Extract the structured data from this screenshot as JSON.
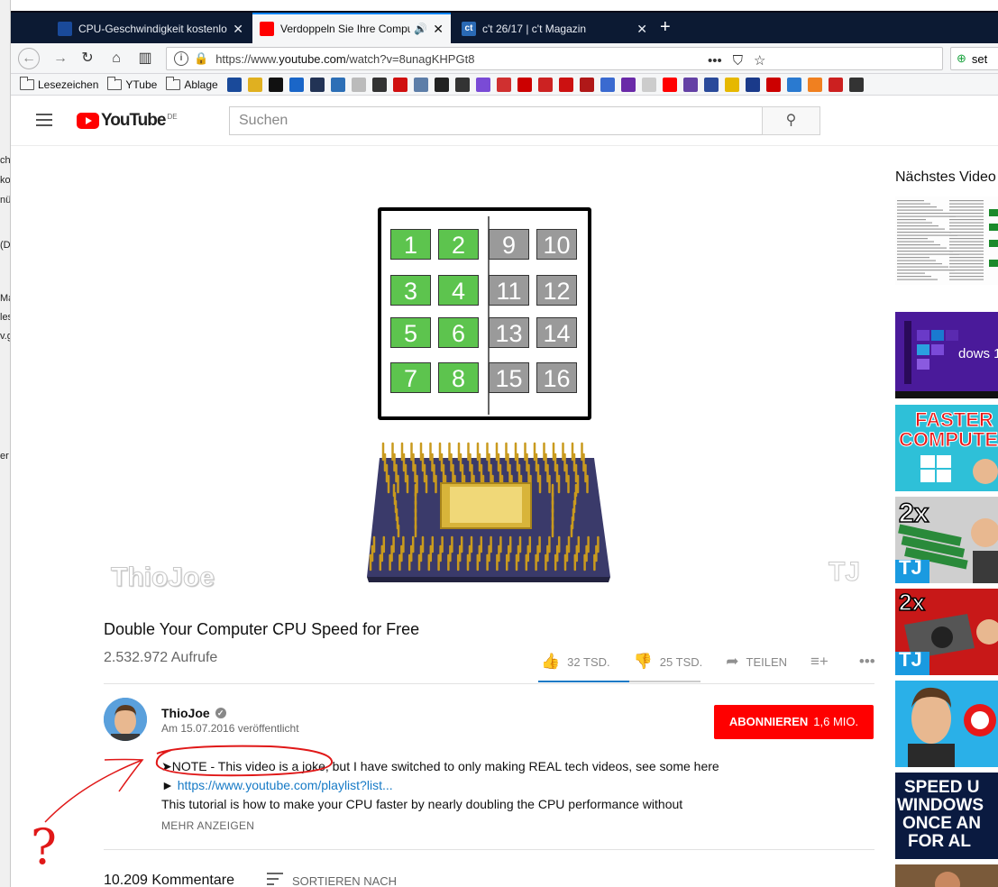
{
  "browser": {
    "tabs": [
      {
        "title": "CPU-Geschwindigkeit kostenlos",
        "favicon": "cb-icon",
        "close": "✕"
      },
      {
        "title": "Verdoppeln Sie Ihre Computer",
        "favicon": "youtube-icon",
        "close": "✕",
        "active": true
      },
      {
        "title": "c't 26/17 | c't Magazin",
        "favicon": "ct-icon",
        "close": "✕"
      }
    ],
    "new_tab": "+",
    "url_prefix": "https://www.",
    "url_host": "youtube.com",
    "url_path": "/watch?v=8unagKHPGt8",
    "search_text": "set",
    "bookmarks": [
      {
        "label": "Lesezeichen"
      },
      {
        "label": "YTube"
      },
      {
        "label": "Ablage"
      }
    ],
    "bookmark_icon_colors": [
      "#1a4a9a",
      "#e0b020",
      "#111111",
      "#1a66c8",
      "#223355",
      "#2d6fb6",
      "#bbbbbb",
      "#333333",
      "#d01010",
      "#5d7ea8",
      "#222222",
      "#333333",
      "#7a4bd6",
      "#d03030",
      "#cc0000",
      "#cc2222",
      "#cc1111",
      "#b01818",
      "#3a6ad0",
      "#6a2aa8",
      "#cccccc",
      "#ff0000",
      "#6441a5",
      "#2a4a9a",
      "#e6b800",
      "#1a3a8a",
      "#cc0000",
      "#2a7ad0",
      "#f08020",
      "#cc2020",
      "#333333"
    ]
  },
  "youtube": {
    "logo_word": "YouTube",
    "region": "DE",
    "search_placeholder": "Suchen",
    "video": {
      "green_cells": [
        "1",
        "2",
        "3",
        "4",
        "5",
        "6",
        "7",
        "8"
      ],
      "gray_cells": [
        "9",
        "10",
        "11",
        "12",
        "13",
        "14",
        "15",
        "16"
      ],
      "watermark_left": "ThioJoe",
      "watermark_right": "TJ"
    },
    "title": "Double Your Computer CPU Speed for Free",
    "views": "2.532.972 Aufrufe",
    "likes": "32 TSD.",
    "dislikes": "25 TSD.",
    "like_ratio": 0.56,
    "share": "TEILEN",
    "channel": "ThioJoe",
    "published": "Am 15.07.2016 veröffentlicht",
    "subscribe": "ABONNIEREN",
    "subscribers": "1,6 MIO.",
    "description": {
      "line1": "➤NOTE - This video is a joke, but I have switched to only making REAL tech videos, see some here",
      "line2_prefix": "► ",
      "line2_link": "https://www.youtube.com/playlist?list...",
      "line3": "This tutorial is how to make your CPU faster by nearly doubling the CPU performance without"
    },
    "show_more": "MEHR ANZEIGEN",
    "comments": "10.209 Kommentare",
    "sort": "SORTIEREN NACH",
    "up_next": "Nächstes Video"
  },
  "sidebar_thumbs": [
    {
      "text": ""
    },
    {
      "text": "dows 1"
    },
    {
      "text_1": "FASTER",
      "text_2": "COMPUTER"
    },
    {
      "text_1": "2x",
      "text_2": "TJ"
    },
    {
      "text_1": "2x",
      "text_2": "TJ"
    },
    {
      "text": ""
    },
    {
      "text_1": "SPEED U",
      "text_2": "WINDOWS",
      "text_3": "ONCE AN",
      "text_4": "FOR AL"
    }
  ],
  "behind_window": [
    "ch",
    "ko",
    "nü",
    "(D",
    "Ma",
    "les",
    "v.g",
    "er"
  ],
  "annotation": {
    "question": "?"
  },
  "colors": {
    "brand_red": "#ff0000",
    "link_blue": "#167ac6",
    "green_cell": "#5dc44e",
    "gray_cell": "#9a9a9a",
    "tabbar": "#0c1a33"
  }
}
